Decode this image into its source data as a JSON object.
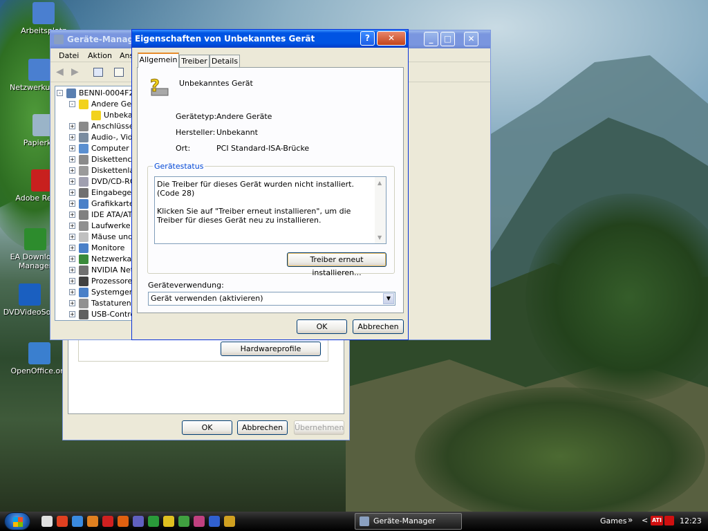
{
  "desktop": {
    "icons": [
      {
        "name": "arbeitsplatz-icon",
        "label": "Arbeitsplatz",
        "color": "#4a7fd0"
      },
      {
        "name": "netzwerk-icon",
        "label": "Netzwerkumgebung",
        "color": "#4a7fd0"
      },
      {
        "name": "papierkorb-icon",
        "label": "Papierkorb",
        "color": "#9ab4c8"
      },
      {
        "name": "adobe-reader-icon",
        "label": "Adobe Reader",
        "color": "#c8201e"
      },
      {
        "name": "ea-download-icon",
        "label": "EA Download Manager",
        "color": "#2d8c2d"
      },
      {
        "name": "dvdvideosoft-icon",
        "label": "DVDVideoSoft",
        "color": "#1a5fc0"
      },
      {
        "name": "openoffice-icon",
        "label": "OpenOffice.org",
        "color": "#3a7fcf"
      }
    ]
  },
  "device_manager": {
    "title": "Geräte-Manager",
    "menu": [
      "Datei",
      "Aktion",
      "Ansicht"
    ],
    "tree": [
      {
        "label": "BENNI-0004F26",
        "level": 0,
        "expander": "-",
        "icon": "computer-icon",
        "color": "#5a7fb0"
      },
      {
        "label": "Andere Geräte",
        "level": 1,
        "expander": "-",
        "icon": "question-icon",
        "color": "#f2d21c"
      },
      {
        "label": "Unbekanntes Gerät",
        "level": 2,
        "expander": "",
        "icon": "unknown-device-icon",
        "color": "#f2d21c"
      },
      {
        "label": "Anschlüsse (COM und LPT)",
        "level": 1,
        "expander": "+",
        "icon": "port-icon",
        "color": "#8a8a8a"
      },
      {
        "label": "Audio-, Video- und Gamecontroller",
        "level": 1,
        "expander": "+",
        "icon": "audio-icon",
        "color": "#7a8ca0"
      },
      {
        "label": "Computer",
        "level": 1,
        "expander": "+",
        "icon": "computer-icon",
        "color": "#5a8fd0"
      },
      {
        "label": "Diskettencontroller",
        "level": 1,
        "expander": "+",
        "icon": "floppy-controller-icon",
        "color": "#8a8a8a"
      },
      {
        "label": "Diskettenlaufwerke",
        "level": 1,
        "expander": "+",
        "icon": "floppy-icon",
        "color": "#9a9a9a"
      },
      {
        "label": "DVD/CD-ROM-Laufwerke",
        "level": 1,
        "expander": "+",
        "icon": "dvd-icon",
        "color": "#a0a0b0"
      },
      {
        "label": "Eingabegeräte (Human Interface Devices)",
        "level": 1,
        "expander": "+",
        "icon": "hid-icon",
        "color": "#707070"
      },
      {
        "label": "Grafikkarte",
        "level": 1,
        "expander": "+",
        "icon": "display-adapter-icon",
        "color": "#4a80c8"
      },
      {
        "label": "IDE ATA/ATAPI-Controller",
        "level": 1,
        "expander": "+",
        "icon": "ide-icon",
        "color": "#808080"
      },
      {
        "label": "Laufwerke",
        "level": 1,
        "expander": "+",
        "icon": "drive-icon",
        "color": "#909090"
      },
      {
        "label": "Mäuse und andere Zeigegeräte",
        "level": 1,
        "expander": "+",
        "icon": "mouse-icon",
        "color": "#c0c0c0"
      },
      {
        "label": "Monitore",
        "level": 1,
        "expander": "+",
        "icon": "monitor-icon",
        "color": "#4a80c8"
      },
      {
        "label": "Netzwerkadapter",
        "level": 1,
        "expander": "+",
        "icon": "network-adapter-icon",
        "color": "#3a8a3a"
      },
      {
        "label": "NVIDIA Network Bus Enumerator",
        "level": 1,
        "expander": "+",
        "icon": "bus-icon",
        "color": "#707070"
      },
      {
        "label": "Prozessoren",
        "level": 1,
        "expander": "+",
        "icon": "processor-icon",
        "color": "#404040"
      },
      {
        "label": "Systemgeräte",
        "level": 1,
        "expander": "+",
        "icon": "system-icon",
        "color": "#4a80c8"
      },
      {
        "label": "Tastaturen",
        "level": 1,
        "expander": "+",
        "icon": "keyboard-icon",
        "color": "#909090"
      },
      {
        "label": "USB-Controller",
        "level": 1,
        "expander": "+",
        "icon": "usb-icon",
        "color": "#606060"
      }
    ]
  },
  "system_props": {
    "hardwareprofile_label": "Hardwareprofile",
    "ok_label": "OK",
    "cancel_label": "Abbrechen",
    "apply_label": "Übernehmen"
  },
  "dialog": {
    "title": "Eigenschaften von Unbekanntes Gerät",
    "tabs": [
      "Allgemein",
      "Treiber",
      "Details"
    ],
    "device_name": "Unbekanntes Gerät",
    "props": [
      {
        "label": "Gerätetyp:",
        "value": "Andere Geräte"
      },
      {
        "label": "Hersteller:",
        "value": "Unbekannt"
      },
      {
        "label": "Ort:",
        "value": "PCI Standard-ISA-Brücke"
      }
    ],
    "status_group": "Gerätestatus",
    "status_line1": "Die Treiber für dieses Gerät wurden nicht installiert. (Code 28)",
    "status_line2": "Klicken Sie auf \"Treiber erneut installieren\", um die Treiber für dieses Gerät neu zu installieren.",
    "reinstall_label": "Treiber erneut installieren...",
    "usage_label": "Geräteverwendung:",
    "usage_value": "Gerät verwenden (aktivieren)",
    "ok_label": "OK",
    "cancel_label": "Abbrechen"
  },
  "taskbar": {
    "active_task": "Geräte-Manager",
    "games_label": "Games",
    "chevron": "»",
    "clock": "12:23",
    "quicklaunch_colors": [
      "#e0e0e0",
      "#e04020",
      "#3a8ae0",
      "#e08020",
      "#d02020",
      "#e06010",
      "#6060c0",
      "#2a9a3a",
      "#e0c020",
      "#40a040",
      "#c04080",
      "#3060d0",
      "#d0a020"
    ]
  }
}
